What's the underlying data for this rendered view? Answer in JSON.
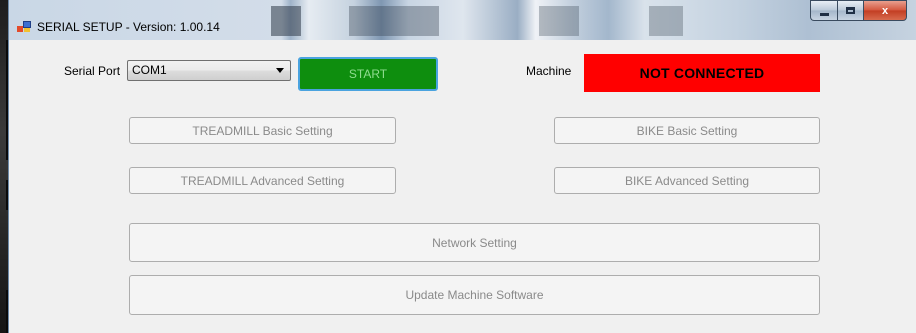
{
  "window": {
    "title": "SERIAL SETUP - Version: 1.00.14",
    "caption_buttons": {
      "minimize": "minimize",
      "maximize": "maximize",
      "close": "x"
    }
  },
  "serial_port": {
    "label": "Serial Port",
    "selected": "COM1"
  },
  "start_button": {
    "label": "START",
    "color": "#0e8e0e"
  },
  "machine": {
    "label": "Machine",
    "status": "NOT CONNECTED",
    "status_color": "#ff0000"
  },
  "buttons": {
    "treadmill_basic": "TREADMILL Basic Setting",
    "bike_basic": "BIKE Basic Setting",
    "treadmill_advanced": "TREADMILL Advanced Setting",
    "bike_advanced": "BIKE Advanced Setting",
    "network": "Network Setting",
    "update_software": "Update Machine Software"
  },
  "icons": {
    "app": "app-window-icon",
    "dropdown": "chevron-down-icon"
  }
}
